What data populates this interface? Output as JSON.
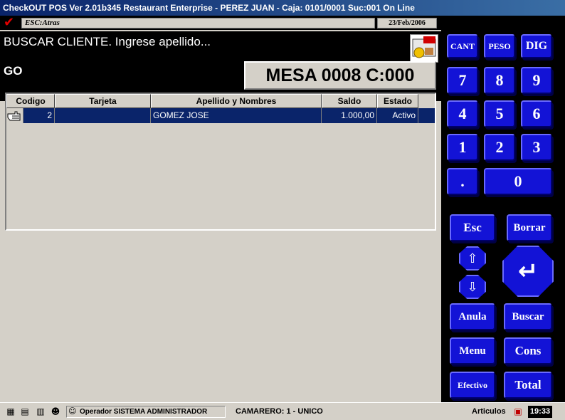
{
  "window": {
    "title": "CheckOUT POS Ver 2.01b345 Restaurant Enterprise - PEREZ JUAN - Caja: 0101/0001 Suc:001  On Line"
  },
  "topbar": {
    "esc_label": "ESC:Atras",
    "date": "23/Feb/2006"
  },
  "message": {
    "prompt": "BUSCAR CLIENTE. Ingrese apellido...",
    "entry": "GO",
    "mesa": "MESA 0008 C:000"
  },
  "grid": {
    "columns": [
      "Codigo",
      "Tarjeta",
      "Apellido y Nombres",
      "Saldo",
      "Estado"
    ],
    "rows": [
      {
        "codigo": "2",
        "tarjeta": "",
        "nombre": "GOMEZ JOSE",
        "saldo": "1.000,00",
        "estado": "Activo"
      }
    ]
  },
  "keypad": {
    "cant": "CANT",
    "peso": "PESO",
    "dig": "DIG",
    "k7": "7",
    "k8": "8",
    "k9": "9",
    "k4": "4",
    "k5": "5",
    "k6": "6",
    "k1": "1",
    "k2": "2",
    "k3": "3",
    "dot": ".",
    "k0": "0",
    "esc": "Esc",
    "borrar": "Borrar",
    "up": "⇧",
    "down": "⇩",
    "enter": "↵",
    "anula": "Anula",
    "buscar": "Buscar",
    "menu": "Menu",
    "cons": "Cons",
    "efectivo": "Efectivo",
    "total": "Total"
  },
  "statusbar": {
    "operador": "Operador  SISTEMA ADMINISTRADOR",
    "camarero": "CAMARERO: 1 -  UNICO",
    "articulos": "Articulos",
    "time": "19:33"
  },
  "colors": {
    "titlebar": "#0a246a",
    "selection": "#0a246a",
    "key": "#1313d6",
    "panel": "#000000",
    "check": "#e00000"
  }
}
